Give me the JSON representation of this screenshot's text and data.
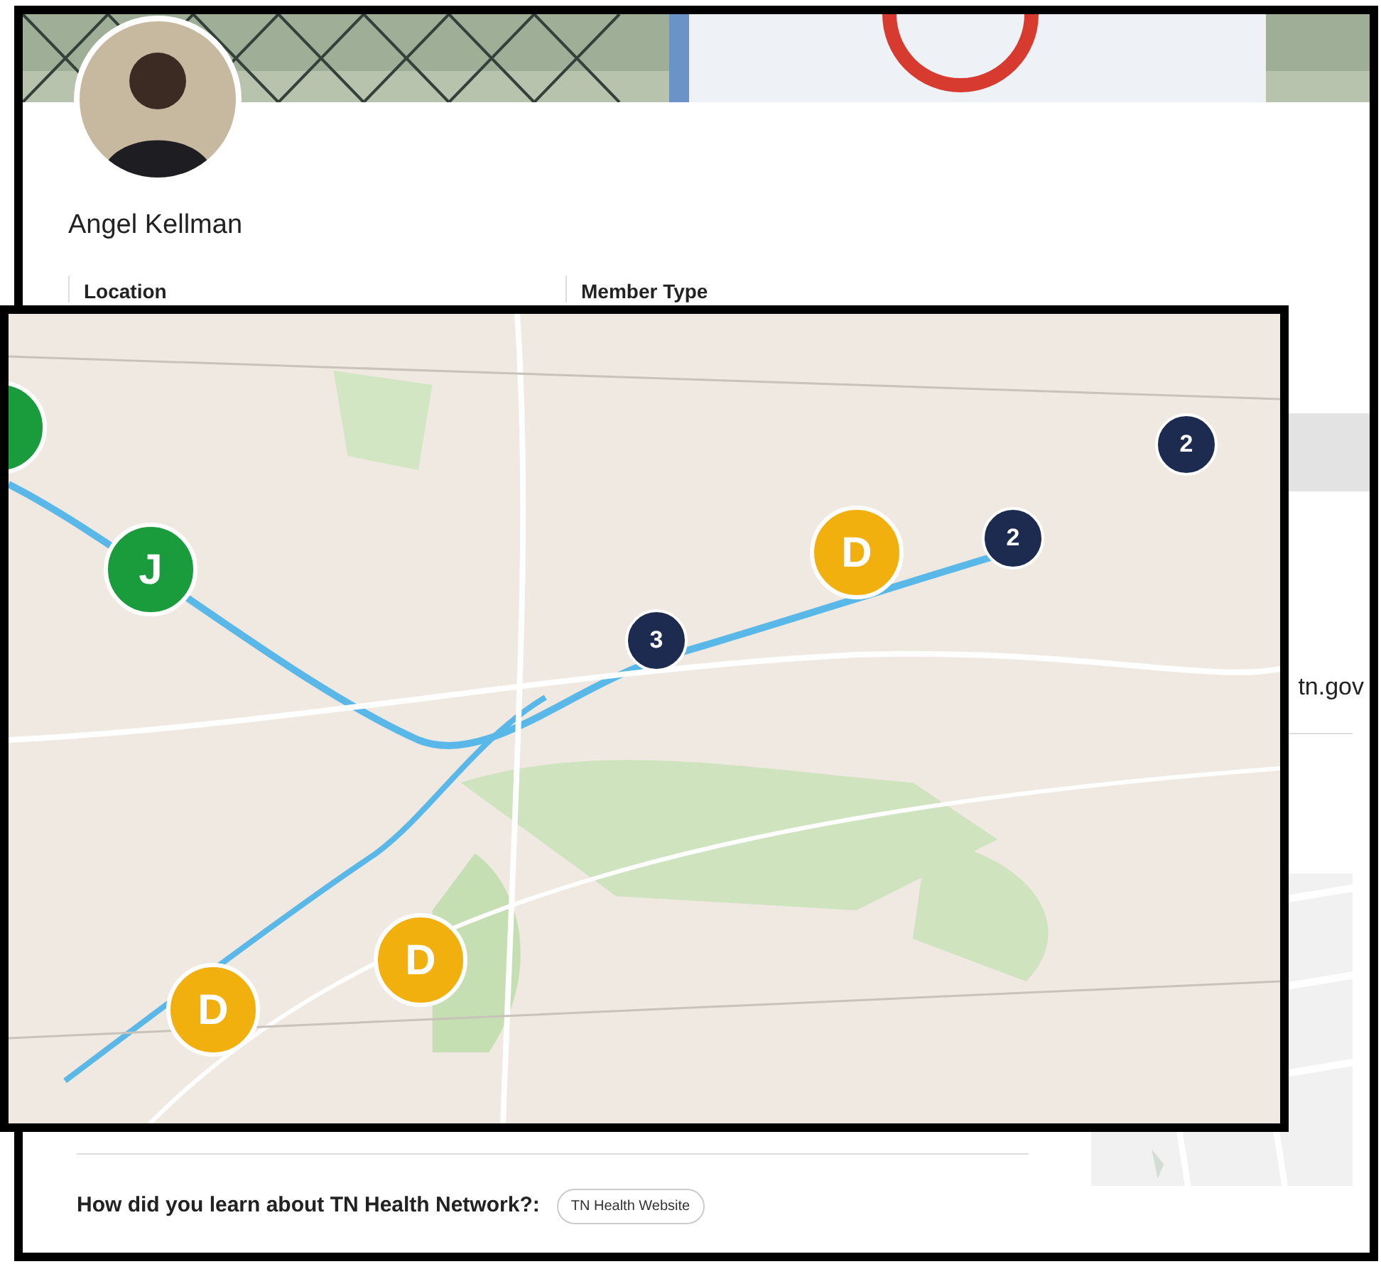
{
  "profile": {
    "name": "Angel Kellman",
    "fields": [
      {
        "label": "Location"
      },
      {
        "label": "Member Type"
      }
    ],
    "email_fragment": "tn.gov",
    "question": {
      "label": "How did you learn about TN Health Network?:",
      "answer": "TN Health Website"
    }
  },
  "map": {
    "markers": [
      {
        "kind": "letter",
        "color": "#1a9b3c"
      },
      {
        "kind": "letter",
        "label": "J",
        "color": "#1a9b3c"
      },
      {
        "kind": "cluster",
        "label": "2",
        "color": "#1c2b4f"
      },
      {
        "kind": "letter",
        "label": "D",
        "color": "#f2b00f"
      },
      {
        "kind": "cluster",
        "label": "2",
        "color": "#1c2b4f"
      },
      {
        "kind": "cluster",
        "label": "3",
        "color": "#1c2b4f"
      },
      {
        "kind": "letter",
        "label": "D",
        "color": "#f2b00f"
      },
      {
        "kind": "letter",
        "label": "D",
        "color": "#f2b00f"
      }
    ]
  }
}
